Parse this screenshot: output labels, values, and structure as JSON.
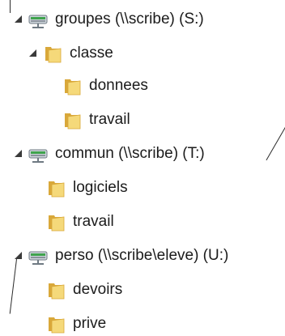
{
  "tree": {
    "items": [
      {
        "label": "groupes (\\\\scribe) (S:)",
        "type": "network-drive",
        "expanded": true
      },
      {
        "label": "classe",
        "type": "folder",
        "expanded": true
      },
      {
        "label": "donnees",
        "type": "folder"
      },
      {
        "label": "travail",
        "type": "folder"
      },
      {
        "label": "commun (\\\\scribe) (T:)",
        "type": "network-drive",
        "expanded": true
      },
      {
        "label": "logiciels",
        "type": "folder"
      },
      {
        "label": "travail",
        "type": "folder"
      },
      {
        "label": "perso (\\\\scribe\\eleve) (U:)",
        "type": "network-drive",
        "expanded": true
      },
      {
        "label": "devoirs",
        "type": "folder"
      },
      {
        "label": "prive",
        "type": "folder"
      }
    ]
  },
  "icons": {
    "network_drive": "network-drive-icon",
    "folder": "folder-icon",
    "expanded_arrow": "expanded-arrow-icon"
  },
  "colors": {
    "folder_light": "#f5d97a",
    "folder_dark": "#d9a83a",
    "drive_green": "#3fa34d",
    "drive_gray": "#8a949c"
  }
}
